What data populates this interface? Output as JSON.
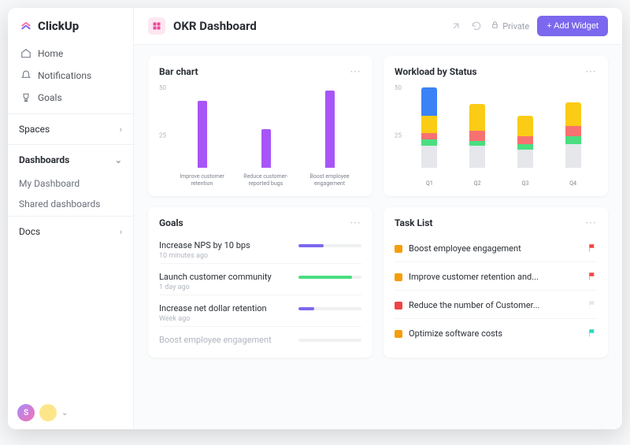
{
  "brand": {
    "name": "ClickUp"
  },
  "nav": {
    "items": [
      {
        "label": "Home"
      },
      {
        "label": "Notifications"
      },
      {
        "label": "Goals"
      }
    ]
  },
  "sections": {
    "spaces": "Spaces",
    "dashboards": "Dashboards",
    "docs": "Docs",
    "subs": [
      {
        "label": "My Dashboard"
      },
      {
        "label": "Shared dashboards"
      }
    ]
  },
  "header": {
    "title": "OKR Dashboard",
    "private": "Private",
    "add_widget": "+ Add Widget"
  },
  "card_bar": {
    "title": "Bar chart"
  },
  "card_workload": {
    "title": "Workload by Status"
  },
  "card_goals": {
    "title": "Goals",
    "items": [
      {
        "name": "Increase NPS by 10 bps",
        "time": "10 minutes ago",
        "percent": 40,
        "color": "#7b68ee"
      },
      {
        "name": "Launch customer community",
        "time": "1 day ago",
        "percent": 85,
        "color": "#4ade80"
      },
      {
        "name": "Increase net dollar retention",
        "time": "Week ago",
        "percent": 25,
        "color": "#7b68ee"
      },
      {
        "name": "Boost employee engagement",
        "time": "",
        "percent": 0,
        "color": "#b0b6bf",
        "faded": true
      }
    ]
  },
  "card_tasks": {
    "title": "Task List",
    "items": [
      {
        "name": "Boost employee engagement",
        "color": "#f59e0b",
        "flag": "#ef4444"
      },
      {
        "name": "Improve customer retention and...",
        "color": "#f59e0b",
        "flag": "#ef4444"
      },
      {
        "name": "Reduce the number of Customer...",
        "color": "#ef4444",
        "flag": "#e5e7eb"
      },
      {
        "name": "Optimize software costs",
        "color": "#f59e0b",
        "flag": "#2dd4bf"
      }
    ]
  },
  "chart_data": [
    {
      "type": "bar",
      "title": "Bar chart",
      "categories": [
        "Improve customer retention",
        "Reduce customer-reported bugs",
        "Boost employee engagement"
      ],
      "values": [
        40,
        23,
        46
      ],
      "ylim": [
        0,
        50
      ],
      "ymid": 25,
      "color": "#a855f7"
    },
    {
      "type": "stacked-bar",
      "title": "Workload by Status",
      "categories": [
        "Q1",
        "Q2",
        "Q3",
        "Q4"
      ],
      "ylim": [
        0,
        50
      ],
      "ymid": 25,
      "series_colors": {
        "blue": "#3b82f6",
        "yellow": "#facc15",
        "red": "#f87171",
        "green": "#4ade80",
        "gray": "#e5e7eb"
      },
      "stacks": [
        {
          "gray": 13,
          "green": 4,
          "red": 4,
          "yellow": 10,
          "blue": 17
        },
        {
          "gray": 13,
          "green": 3,
          "red": 6,
          "yellow": 16,
          "blue": 0
        },
        {
          "gray": 11,
          "green": 3,
          "red": 5,
          "yellow": 12,
          "blue": 0
        },
        {
          "gray": 14,
          "green": 5,
          "red": 6,
          "yellow": 14,
          "blue": 0
        }
      ]
    }
  ]
}
